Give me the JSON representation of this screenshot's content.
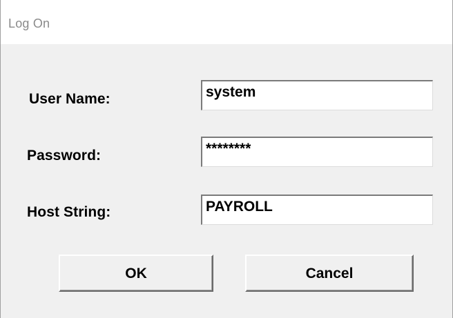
{
  "window": {
    "title": "Log On"
  },
  "form": {
    "username_label": "User Name:",
    "username_value": "system",
    "password_label": "Password:",
    "password_value": "********",
    "host_label": "Host String:",
    "host_value": "PAYROLL"
  },
  "buttons": {
    "ok_label": "OK",
    "cancel_label": "Cancel"
  }
}
